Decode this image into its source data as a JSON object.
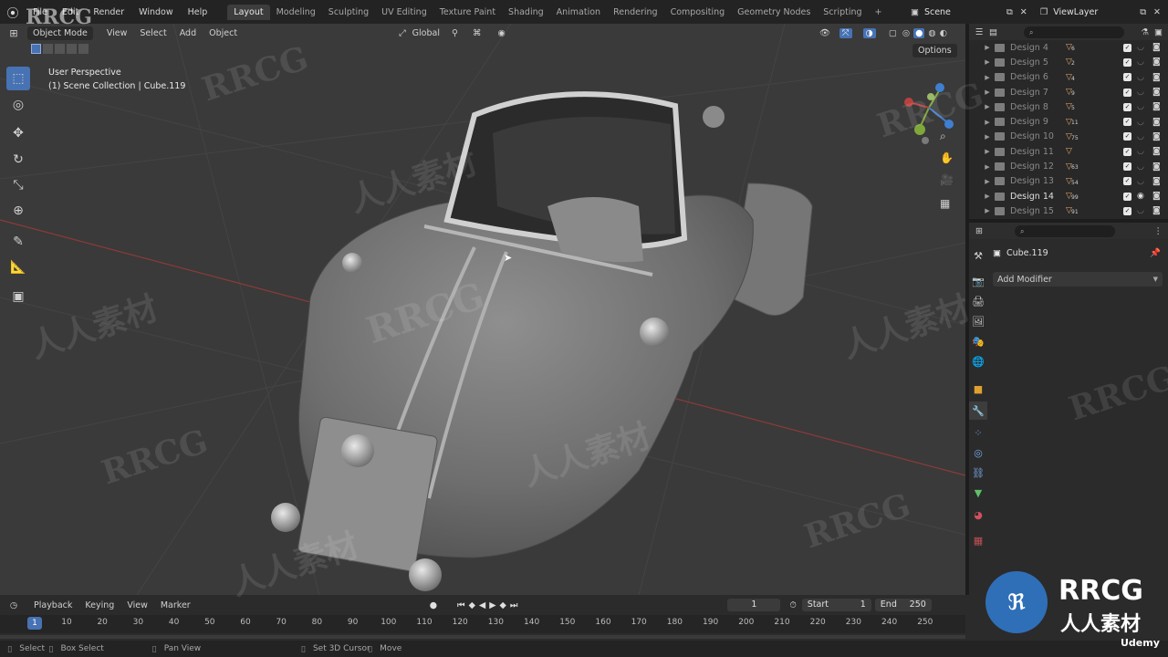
{
  "menu": [
    "File",
    "Edit",
    "Render",
    "Window",
    "Help"
  ],
  "workspaces": [
    "Layout",
    "Modeling",
    "Sculpting",
    "UV Editing",
    "Texture Paint",
    "Shading",
    "Animation",
    "Rendering",
    "Compositing",
    "Geometry Nodes",
    "Scripting"
  ],
  "active_workspace": "Layout",
  "scene": "Scene",
  "view_layer": "ViewLayer",
  "viewport": {
    "mode": "Object Mode",
    "menus": [
      "View",
      "Select",
      "Add",
      "Object"
    ],
    "orientation": "Global",
    "options": "Options",
    "perspective": "User Perspective",
    "collection_info": "(1) Scene Collection | Cube.119"
  },
  "outliner": {
    "rows": [
      {
        "name": "Design 4",
        "num": "6",
        "visible": false
      },
      {
        "name": "Design 5",
        "num": "2",
        "visible": false
      },
      {
        "name": "Design 6",
        "num": "4",
        "visible": false
      },
      {
        "name": "Design 7",
        "num": "9",
        "visible": false
      },
      {
        "name": "Design 8",
        "num": "5",
        "visible": false
      },
      {
        "name": "Design 9",
        "num": "11",
        "visible": false
      },
      {
        "name": "Design 10",
        "num": "75",
        "visible": false
      },
      {
        "name": "Design 11",
        "num": "",
        "visible": false
      },
      {
        "name": "Design 12",
        "num": "63",
        "visible": false
      },
      {
        "name": "Design 13",
        "num": "54",
        "visible": false
      },
      {
        "name": "Design 14",
        "num": "99",
        "visible": true
      },
      {
        "name": "Design 15",
        "num": "91",
        "visible": false
      }
    ]
  },
  "properties": {
    "object_name": "Cube.119",
    "add_modifier": "Add Modifier"
  },
  "timeline": {
    "menus": [
      "Playback",
      "Keying",
      "View",
      "Marker"
    ],
    "current_frame": "1",
    "start_label": "Start",
    "start": "1",
    "end_label": "End",
    "end": "250",
    "ticks": [
      "10",
      "20",
      "30",
      "40",
      "50",
      "60",
      "70",
      "80",
      "90",
      "100",
      "110",
      "120",
      "130",
      "140",
      "150",
      "160",
      "170",
      "180",
      "190",
      "200",
      "210",
      "220",
      "230",
      "240",
      "250"
    ],
    "playhead": "1"
  },
  "statusbar": [
    "Select",
    "Box Select",
    "Pan View",
    "Set 3D Cursor",
    "Move"
  ],
  "watermarks": {
    "rrcg": "RRCG",
    "cn": "人人素材",
    "udemy": "Udemy"
  },
  "colors": {
    "accent": "#4772b3",
    "x_axis": "#b8413f",
    "y_axis": "#7fa83a",
    "z_axis": "#3f7fd1"
  }
}
